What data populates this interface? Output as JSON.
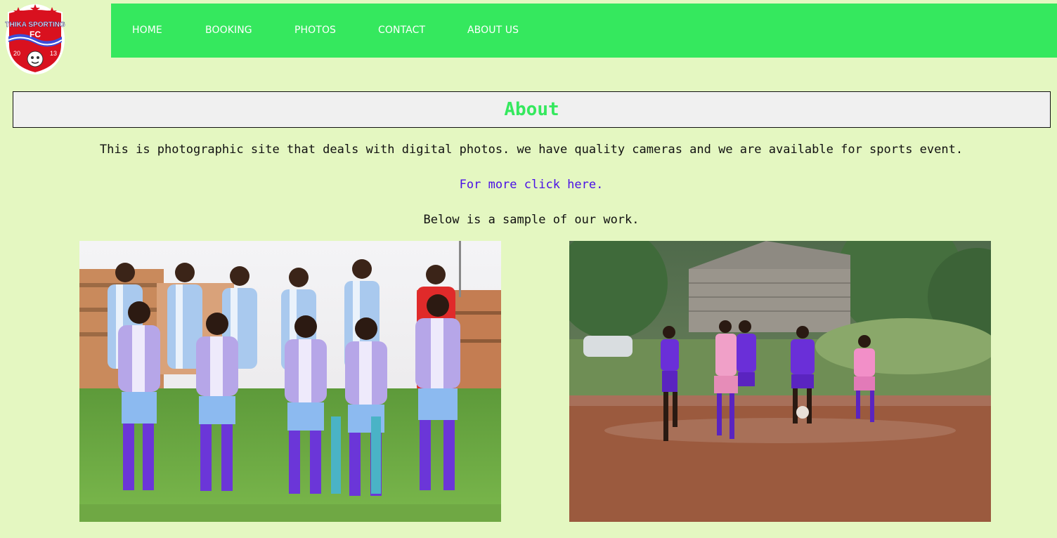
{
  "header": {
    "logo": {
      "top_text": "THIKA SPORTING",
      "fc_text": "FC",
      "year_left": "20",
      "year_right": "13"
    },
    "nav": [
      {
        "label": "HOME"
      },
      {
        "label": "BOOKING"
      },
      {
        "label": "PHOTOS"
      },
      {
        "label": "CONTACT"
      },
      {
        "label": "ABOUT US"
      }
    ]
  },
  "main": {
    "title": "About",
    "description": "This is photographic site that deals with digital photos. we have quality cameras and we are available for sports event.",
    "more_link": "For more click here.",
    "sample_text": "Below is a sample of our work."
  },
  "colors": {
    "page_background": "#e4f7c1",
    "nav_background": "#35e85e",
    "title_color": "#35e85e",
    "link_color": "#4a10e6"
  }
}
